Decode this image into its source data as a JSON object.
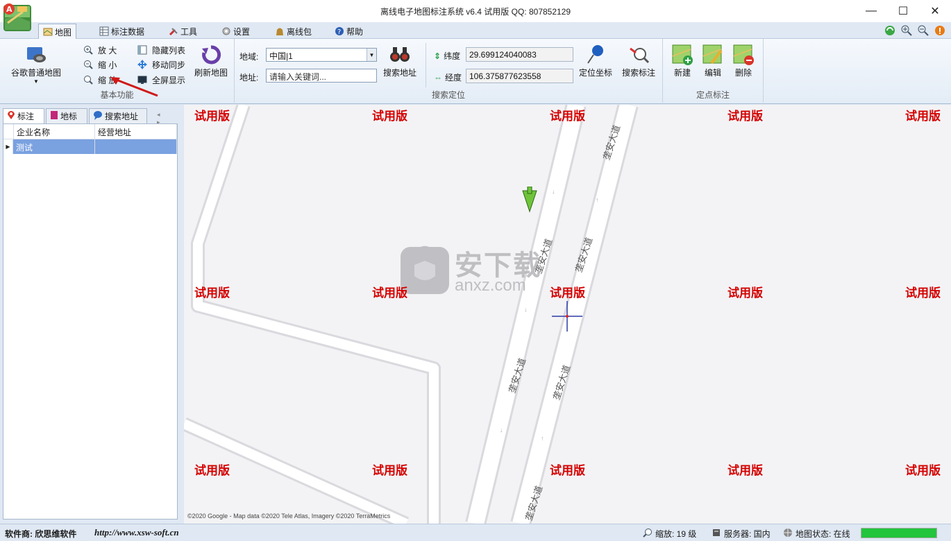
{
  "window": {
    "title": "离线电子地图标注系统 v6.4 试用版 QQ:  807852129",
    "minimize": "—",
    "maximize": "☐",
    "close": "✕"
  },
  "menu_tabs": [
    {
      "label": "地图",
      "icon": "map-icon",
      "active": true
    },
    {
      "label": "标注数据",
      "icon": "table-icon",
      "active": false
    },
    {
      "label": "工具",
      "icon": "tools-icon",
      "active": false
    },
    {
      "label": "设置",
      "icon": "settings-icon",
      "active": false
    },
    {
      "label": "离线包",
      "icon": "package-icon",
      "active": false
    },
    {
      "label": "帮助",
      "icon": "help-icon",
      "active": false
    }
  ],
  "ribbon": {
    "basic": {
      "caption": "基本功能",
      "map_type_button": "谷歌普通地图",
      "zoom_in": "放 大",
      "zoom_out": "缩 小",
      "zoom_fit": "缩 放",
      "hide_list": "隐藏列表",
      "move_sync": "移动同步",
      "fullscreen": "全屏显示",
      "refresh_map": "刷新地图"
    },
    "search": {
      "caption": "搜索定位",
      "region_label": "地域:",
      "region_value": "中国|1",
      "address_label": "地址:",
      "address_placeholder": "请输入关键词...",
      "search_address_button": "搜索地址",
      "lat_label": "纬度",
      "lat_value": "29.699124040083",
      "lng_label": "经度",
      "lng_value": "106.375877623558",
      "locate_button": "定位坐标",
      "search_marker_button": "搜索标注"
    },
    "marker": {
      "caption": "定点标注",
      "new_button": "新建",
      "edit_button": "编辑",
      "delete_button": "删除"
    }
  },
  "left_panel": {
    "tabs": [
      "标注",
      "地标",
      "搜索地址"
    ],
    "columns": [
      "企业名称",
      "经营地址"
    ],
    "rows": [
      {
        "name": "测试",
        "address": ""
      }
    ]
  },
  "map": {
    "trial_text": "试用版",
    "road_name": "垄安大道",
    "copyright": "©2020 Google - Map data ©2020 Tele Atlas, Imagery ©2020 TerraMetrics",
    "watermark_text": "安下载",
    "watermark_sub": "anxz.com"
  },
  "status": {
    "vendor": "软件商: 欣思维软件",
    "url": "http://www.xsw-soft.cn",
    "zoom": "缩放: 19 级",
    "server": "服务器: 国内",
    "map_state": "地图状态: 在线",
    "progress": 1.0,
    "progress_color": "#22c53c"
  }
}
